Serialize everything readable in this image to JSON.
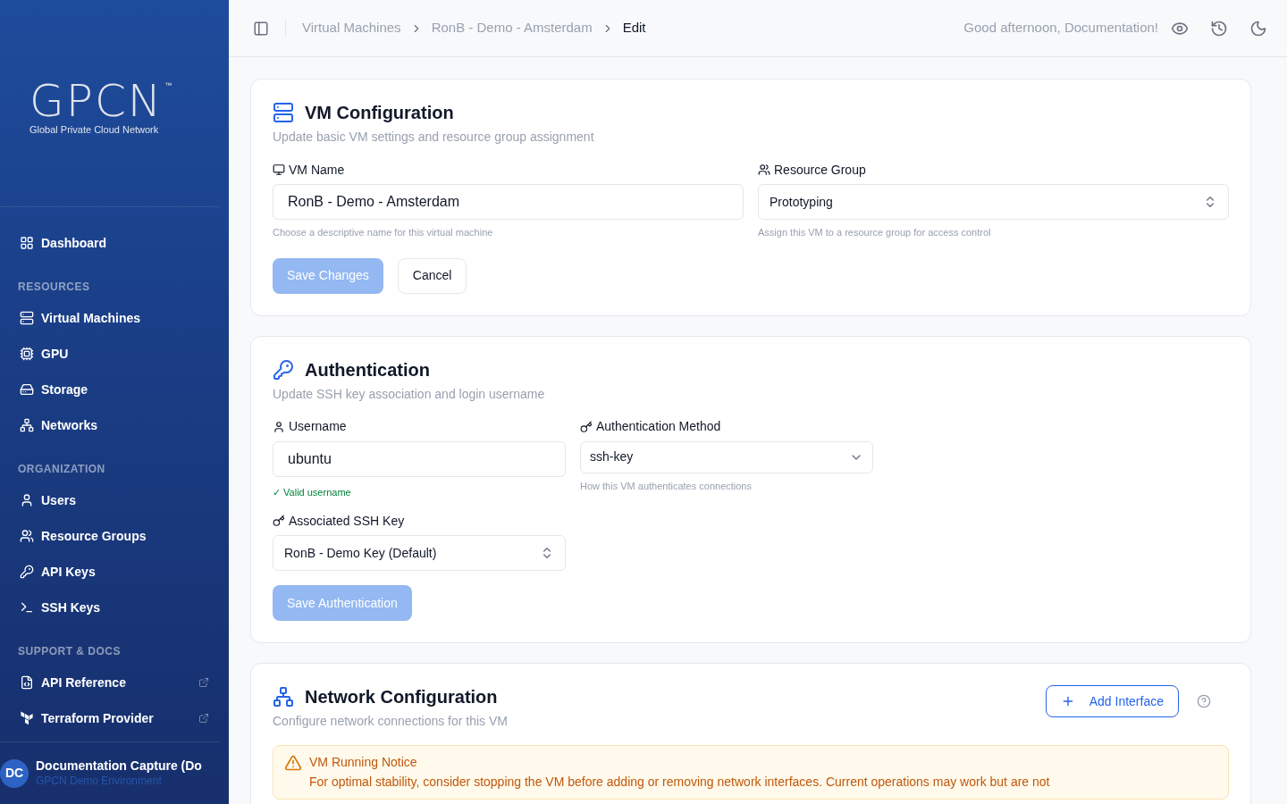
{
  "sidebar": {
    "logo": {
      "mark": "GPCN",
      "tm": "™",
      "tagline": "Global Private Cloud Network"
    },
    "top_items": [
      {
        "label": "Dashboard"
      }
    ],
    "sections": [
      {
        "title": "RESOURCES",
        "items": [
          {
            "label": "Virtual Machines"
          },
          {
            "label": "GPU"
          },
          {
            "label": "Storage"
          },
          {
            "label": "Networks"
          }
        ]
      },
      {
        "title": "ORGANIZATION",
        "items": [
          {
            "label": "Users"
          },
          {
            "label": "Resource Groups"
          },
          {
            "label": "API Keys"
          },
          {
            "label": "SSH Keys"
          }
        ]
      },
      {
        "title": "SUPPORT & DOCS",
        "items": [
          {
            "label": "API Reference",
            "external": true
          },
          {
            "label": "Terraform Provider",
            "external": true
          }
        ]
      }
    ],
    "user": {
      "initials": "DC",
      "name": "Documentation Capture (Do",
      "subtitle": "GPCN Demo Environment"
    }
  },
  "header": {
    "breadcrumbs": [
      {
        "label": "Virtual Machines",
        "selected": false
      },
      {
        "label": "RonB - Demo - Amsterdam",
        "selected": false
      },
      {
        "label": "Edit",
        "selected": true
      }
    ],
    "greeting": "Good afternoon, Documentation!"
  },
  "vm_config": {
    "title": "VM Configuration",
    "subtitle": "Update basic VM settings and resource group assignment",
    "fields": [
      {
        "label": "VM Name",
        "kind": "input",
        "value": "RonB - Demo - Amsterdam",
        "hint": "Choose a descriptive name for this virtual machine"
      },
      {
        "label": "Resource Group",
        "kind": "select",
        "value": "Prototyping",
        "hint": "Assign this VM to a resource group for access control"
      }
    ],
    "buttons": [
      {
        "label": "Save Changes",
        "kind": "primary",
        "disabled": true
      },
      {
        "label": "Cancel",
        "kind": "outline",
        "disabled": false
      }
    ]
  },
  "authentication": {
    "title": "Authentication",
    "subtitle": "Update SSH key association and login username",
    "fields": [
      {
        "label": "Username",
        "kind": "input",
        "value": "ubuntu",
        "valid": "✓ Valid username"
      },
      {
        "label": "Authentication Method",
        "kind": "dropdown",
        "value": "ssh-key",
        "hint": "How this VM authenticates connections"
      },
      {
        "label": "Associated SSH Key",
        "kind": "select",
        "value": "RonB - Demo Key (Default)"
      }
    ],
    "buttons": [
      {
        "label": "Save Authentication",
        "kind": "primary",
        "disabled": true
      }
    ]
  },
  "network": {
    "title": "Network Configuration",
    "subtitle": "Configure network connections for this VM",
    "add_button": "Add Interface",
    "notice": {
      "title": "VM Running Notice",
      "text": "For optimal stability, consider stopping the VM before adding or removing network interfaces. Current operations may work but are not"
    }
  }
}
